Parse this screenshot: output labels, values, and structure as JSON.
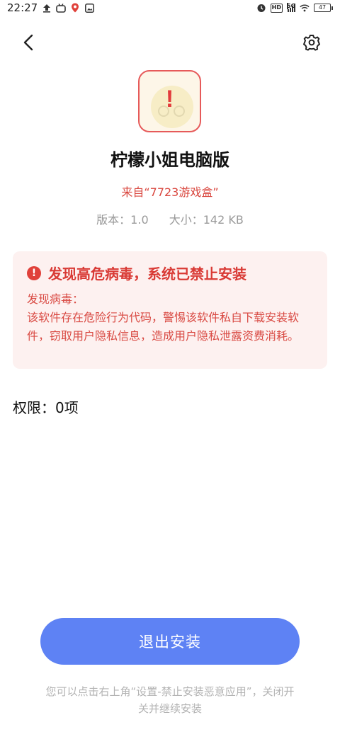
{
  "status_bar": {
    "time": "22:27",
    "hd": "HD",
    "network": "5G",
    "battery": "47"
  },
  "app": {
    "name": "柠檬小姐电脑版",
    "source": "来自“7723游戏盒”",
    "version": "版本：1.0",
    "size": "大小：142 KB",
    "icon_mark": "!"
  },
  "warning": {
    "title": "发现高危病毒，系统已禁止安装",
    "label": "发现病毒：",
    "description": "该软件存在危险行为代码，警惕该软件私自下载安装软件，窃取用户隐私信息，造成用户隐私泄露资费消耗。"
  },
  "permissions": {
    "text": "权限：0项"
  },
  "actions": {
    "exit_label": "退出安装"
  },
  "hint": {
    "text": "您可以点击右上角“设置-禁止安装恶意应用”，关闭开关并继续安装"
  },
  "colors": {
    "danger": "#d93a35",
    "button": "#5e82f4",
    "card_bg": "#fdf1f0"
  },
  "icons": [
    "back-arrow-icon",
    "gear-icon",
    "alert-icon"
  ]
}
